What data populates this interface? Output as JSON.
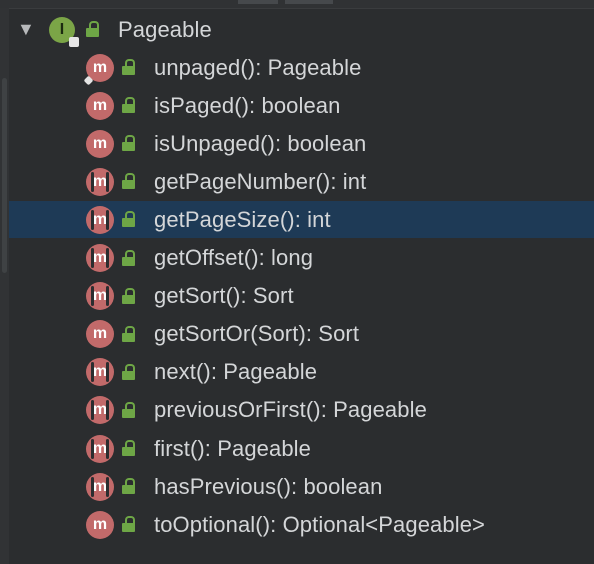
{
  "tree": {
    "root": {
      "label": "Pageable",
      "kind_icon": "interface-icon",
      "kind_letter": "I",
      "expanded": true
    },
    "members": [
      {
        "label": "unpaged(): Pageable",
        "icon": "method-icon",
        "letter": "m",
        "abstract": false,
        "static": true
      },
      {
        "label": "isPaged(): boolean",
        "icon": "method-icon",
        "letter": "m",
        "abstract": false,
        "static": false
      },
      {
        "label": "isUnpaged(): boolean",
        "icon": "method-icon",
        "letter": "m",
        "abstract": false,
        "static": false
      },
      {
        "label": "getPageNumber(): int",
        "icon": "abstract-method-icon",
        "letter": "m",
        "abstract": true,
        "static": false
      },
      {
        "label": "getPageSize(): int",
        "icon": "abstract-method-icon",
        "letter": "m",
        "abstract": true,
        "static": false,
        "selected": true
      },
      {
        "label": "getOffset(): long",
        "icon": "abstract-method-icon",
        "letter": "m",
        "abstract": true,
        "static": false
      },
      {
        "label": "getSort(): Sort",
        "icon": "abstract-method-icon",
        "letter": "m",
        "abstract": true,
        "static": false
      },
      {
        "label": "getSortOr(Sort): Sort",
        "icon": "method-icon",
        "letter": "m",
        "abstract": false,
        "static": false
      },
      {
        "label": "next(): Pageable",
        "icon": "abstract-method-icon",
        "letter": "m",
        "abstract": true,
        "static": false
      },
      {
        "label": "previousOrFirst(): Pageable",
        "icon": "abstract-method-icon",
        "letter": "m",
        "abstract": true,
        "static": false
      },
      {
        "label": "first(): Pageable",
        "icon": "abstract-method-icon",
        "letter": "m",
        "abstract": true,
        "static": false
      },
      {
        "label": "hasPrevious(): boolean",
        "icon": "abstract-method-icon",
        "letter": "m",
        "abstract": true,
        "static": false
      },
      {
        "label": "toOptional(): Optional<Pageable>",
        "icon": "method-icon",
        "letter": "m",
        "abstract": false,
        "static": false
      }
    ]
  },
  "colors": {
    "background": "#2b2d2f",
    "selection": "#1e3a56",
    "method_badge": "#c26a6a",
    "interface_badge": "#7ba547",
    "public_lock": "#6ea646",
    "text": "#d4d6d8"
  }
}
